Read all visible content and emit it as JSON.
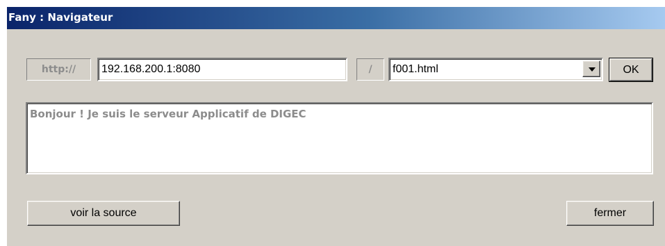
{
  "window": {
    "title": "Fany : Navigateur"
  },
  "address_bar": {
    "protocol_label": "http://",
    "host_value": "192.168.200.1:8080",
    "separator_label": "/",
    "page_selected": "f001.html",
    "ok_label": "OK"
  },
  "response": {
    "text": "Bonjour ! Je suis le serveur Applicatif de DIGEC"
  },
  "footer": {
    "view_source_label": "voir la source",
    "close_label": "fermer"
  },
  "icons": {
    "dropdown": "chevron-down-icon"
  },
  "colors": {
    "title_gradient_start": "#0a246a",
    "title_gradient_end": "#a6caf0",
    "window_bg": "#d4d0c8",
    "disabled_text": "#8c8c8c"
  }
}
